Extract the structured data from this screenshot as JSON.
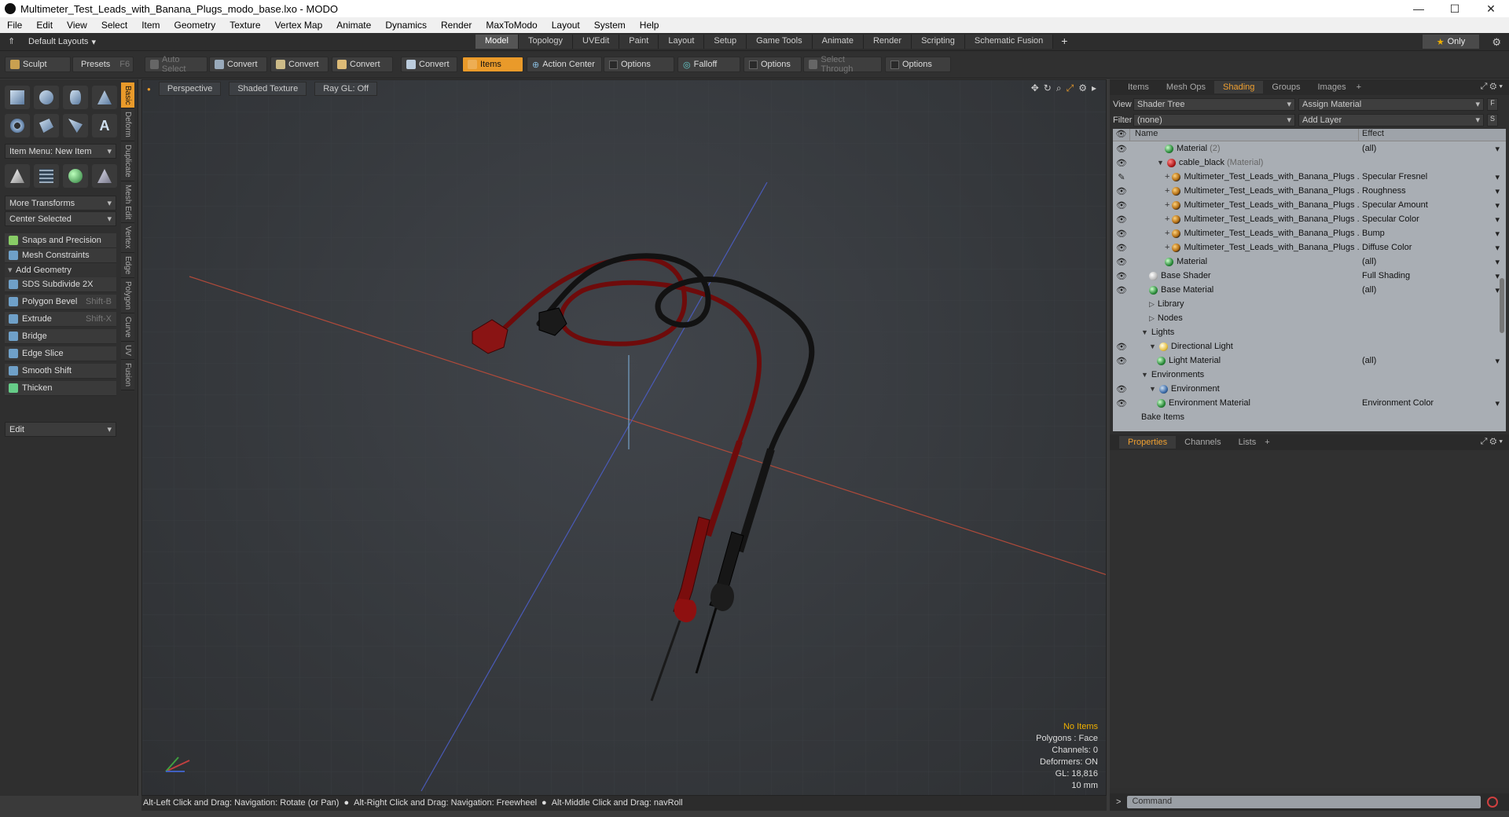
{
  "window": {
    "title": "Multimeter_Test_Leads_with_Banana_Plugs_modo_base.lxo - MODO",
    "minimize": "—",
    "maximize": "☐",
    "close": "✕"
  },
  "menubar": [
    "File",
    "Edit",
    "View",
    "Select",
    "Item",
    "Geometry",
    "Texture",
    "Vertex Map",
    "Animate",
    "Dynamics",
    "Render",
    "MaxToModo",
    "Layout",
    "System",
    "Help"
  ],
  "layouts": {
    "label": "Default Layouts"
  },
  "mode_tabs": [
    "Model",
    "Topology",
    "UVEdit",
    "Paint",
    "Layout",
    "Setup",
    "Game Tools",
    "Animate",
    "Render",
    "Scripting",
    "Schematic Fusion"
  ],
  "mode_tabs_plus": "+",
  "only_label": "Only",
  "toolbar": {
    "sculpt": "Sculpt",
    "presets": "Presets",
    "presets_shortcut": "F6",
    "auto_select": "Auto Select",
    "convert1": "Convert",
    "convert2": "Convert",
    "convert3": "Convert",
    "convert4": "Convert",
    "items": "Items",
    "action_center": "Action Center",
    "options1": "Options",
    "falloff": "Falloff",
    "options2": "Options",
    "select_through": "Select Through",
    "options3": "Options"
  },
  "left_panel": {
    "item_menu": "Item Menu: New Item",
    "more_transforms": "More Transforms",
    "center_selected": "Center Selected",
    "snaps": "Snaps and Precision",
    "mesh_constraints": "Mesh Constraints",
    "add_geometry": "Add Geometry",
    "tools": [
      {
        "label": "SDS Subdivide 2X",
        "shortcut": ""
      },
      {
        "label": "Polygon Bevel",
        "shortcut": "Shift-B"
      },
      {
        "label": "Extrude",
        "shortcut": "Shift-X"
      },
      {
        "label": "Bridge",
        "shortcut": ""
      },
      {
        "label": "Edge Slice",
        "shortcut": ""
      },
      {
        "label": "Smooth Shift",
        "shortcut": ""
      },
      {
        "label": "Thicken",
        "shortcut": ""
      }
    ],
    "edit_dropdown": "Edit",
    "vertical_tabs": [
      "Basic",
      "Deform",
      "Duplicate",
      "Mesh Edit",
      "Vertex",
      "Edge",
      "Polygon",
      "Curve",
      "UV",
      "Fusion"
    ]
  },
  "viewport": {
    "view_mode": "Perspective",
    "shading": "Shaded Texture",
    "raygl": "Ray GL: Off",
    "info": {
      "no_items": "No Items",
      "polygons": "Polygons : Face",
      "channels": "Channels: 0",
      "deformers": "Deformers: ON",
      "gl": "GL: 18,816",
      "scale": "10 mm"
    }
  },
  "statusbar": {
    "hint1": "Alt-Left Click and Drag: Navigation: Rotate (or Pan)",
    "hint2": "Alt-Right Click and Drag: Navigation: Freewheel",
    "hint3": "Alt-Middle Click and Drag: navRoll"
  },
  "right_panel": {
    "tabs": [
      "Items",
      "Mesh Ops",
      "Shading",
      "Groups",
      "Images"
    ],
    "tabs_plus": "+",
    "view_label": "View",
    "view_value": "Shader Tree",
    "assign_material": "Assign Material",
    "f_btn": "F",
    "filter_label": "Filter",
    "filter_value": "(none)",
    "add_layer": "Add Layer",
    "s_btn": "S",
    "tree_header": {
      "name": "Name",
      "effect": "Effect"
    },
    "tree_rows": [
      {
        "name": "Material",
        "suffix": "(2)",
        "effect": "(all)",
        "icon": "ball",
        "indent": 4
      },
      {
        "name": "cable_black",
        "suffix": "(Material)",
        "effect": "",
        "icon": "mat",
        "indent": 3
      },
      {
        "name": "Multimeter_Test_Leads_with_Banana_Plugs ...",
        "suffix": "",
        "effect": "Specular Fresnel",
        "icon": "tex",
        "indent": 4
      },
      {
        "name": "Multimeter_Test_Leads_with_Banana_Plugs ...",
        "suffix": "",
        "effect": "Roughness",
        "icon": "tex",
        "indent": 4
      },
      {
        "name": "Multimeter_Test_Leads_with_Banana_Plugs ...",
        "suffix": "",
        "effect": "Specular Amount",
        "icon": "tex",
        "indent": 4
      },
      {
        "name": "Multimeter_Test_Leads_with_Banana_Plugs ...",
        "suffix": "",
        "effect": "Specular Color",
        "icon": "tex",
        "indent": 4
      },
      {
        "name": "Multimeter_Test_Leads_with_Banana_Plugs ...",
        "suffix": "",
        "effect": "Bump",
        "icon": "tex",
        "indent": 4
      },
      {
        "name": "Multimeter_Test_Leads_with_Banana_Plugs ...",
        "suffix": "",
        "effect": "Diffuse Color",
        "icon": "tex",
        "indent": 4
      },
      {
        "name": "Material",
        "suffix": "",
        "effect": "(all)",
        "icon": "ball",
        "indent": 4
      },
      {
        "name": "Base Shader",
        "suffix": "",
        "effect": "Full Shading",
        "icon": "shader",
        "indent": 2
      },
      {
        "name": "Base Material",
        "suffix": "",
        "effect": "(all)",
        "icon": "ball",
        "indent": 2
      },
      {
        "name": "Library",
        "suffix": "",
        "effect": "",
        "icon": "folder",
        "indent": 2
      },
      {
        "name": "Nodes",
        "suffix": "",
        "effect": "",
        "icon": "folder",
        "indent": 2
      },
      {
        "name": "Lights",
        "suffix": "",
        "effect": "",
        "icon": "none",
        "indent": 1
      },
      {
        "name": "Directional Light",
        "suffix": "",
        "effect": "",
        "icon": "light",
        "indent": 2
      },
      {
        "name": "Light Material",
        "suffix": "",
        "effect": "(all)",
        "icon": "ball",
        "indent": 3
      },
      {
        "name": "Environments",
        "suffix": "",
        "effect": "",
        "icon": "none",
        "indent": 1
      },
      {
        "name": "Environment",
        "suffix": "",
        "effect": "",
        "icon": "env",
        "indent": 2
      },
      {
        "name": "Environment Material",
        "suffix": "",
        "effect": "Environment Color",
        "icon": "ball",
        "indent": 3
      },
      {
        "name": "Bake Items",
        "suffix": "",
        "effect": "",
        "icon": "none",
        "indent": 1
      }
    ],
    "props_tabs": [
      "Properties",
      "Channels",
      "Lists"
    ],
    "props_plus": "+",
    "command_placeholder": "Command"
  },
  "colors": {
    "accent": "#e99a2a",
    "cable_red": "#7a0d0d",
    "cable_black": "#141414"
  }
}
